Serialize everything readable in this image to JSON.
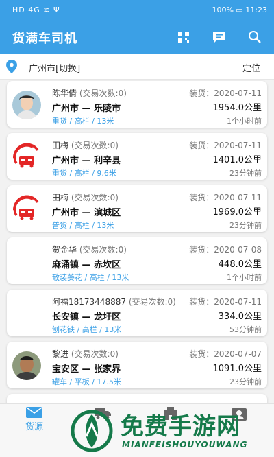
{
  "status": {
    "left": "HD 4G ≋ Ψ",
    "right": "100% ▭ 11:23"
  },
  "header": {
    "title": "货满车司机"
  },
  "icons": {
    "scan": "qr-scan-icon",
    "message": "message-icon",
    "search": "search-icon",
    "location": "location-pin-icon"
  },
  "location": {
    "city": "广州市[切换]",
    "locate_label": "定位"
  },
  "colors": {
    "primary": "#3ba0e6"
  },
  "cards": [
    {
      "driver": "陈华倩",
      "trades": "(交易次数:0)",
      "route_from": "广州市",
      "route_sep": "—",
      "route_to": "乐陵市",
      "load_date": "装货：2020-07-11",
      "distance": "1954.0公里",
      "tags": "重货 / 高栏 / 13米",
      "ago": "1个小时前",
      "avatar": "photo-woman"
    },
    {
      "driver": "田梅",
      "trades": "(交易次数:0)",
      "route_from": "广州市",
      "route_sep": "—",
      "route_to": "利辛县",
      "load_date": "装货：2020-07-11",
      "distance": "1401.0公里",
      "tags": "重货 / 高栏 / 9.6米",
      "ago": "23分钟前",
      "avatar": "truck-logo"
    },
    {
      "driver": "田梅",
      "trades": "(交易次数:0)",
      "route_from": "广州市",
      "route_sep": "—",
      "route_to": "滨城区",
      "load_date": "装货：2020-07-11",
      "distance": "1969.0公里",
      "tags": "普货 / 高栏 / 13米",
      "ago": "23分钟前",
      "avatar": "truck-logo"
    },
    {
      "driver": "贺金华",
      "trades": "(交易次数:0)",
      "route_from": "麻涌镇",
      "route_sep": "—",
      "route_to": "赤坎区",
      "load_date": "装货：2020-07-08",
      "distance": "448.0公里",
      "tags": "散装葵花 / 高栏 / 13米",
      "ago": "1个小时前",
      "avatar": "none"
    },
    {
      "driver": "阿福18173448887",
      "trades": "(交易次数:0)",
      "route_from": "长安镇",
      "route_sep": "—",
      "route_to": "龙圩区",
      "load_date": "装货：2020-07-11",
      "distance": "334.0公里",
      "tags": "刨花铁 / 高栏 / 13米",
      "ago": "53分钟前",
      "avatar": "none"
    },
    {
      "driver": "黎进",
      "trades": "(交易次数:0)",
      "route_from": "宝安区",
      "route_sep": "—",
      "route_to": "张家界",
      "load_date": "装货：2020-07-07",
      "distance": "1091.0公里",
      "tags": "罐车 / 平板 / 17.5米",
      "ago": "23分钟前",
      "avatar": "photo-man"
    }
  ],
  "tabs": [
    {
      "label": "货源",
      "icon": "mail-icon"
    },
    {
      "label": "",
      "icon": "truck-icon"
    },
    {
      "label": "",
      "icon": "company-icon"
    },
    {
      "label": "",
      "icon": "profile-icon"
    }
  ],
  "watermark": {
    "title": "免费手游网",
    "subtitle": "MIANFEISHOUYOUWANG"
  }
}
